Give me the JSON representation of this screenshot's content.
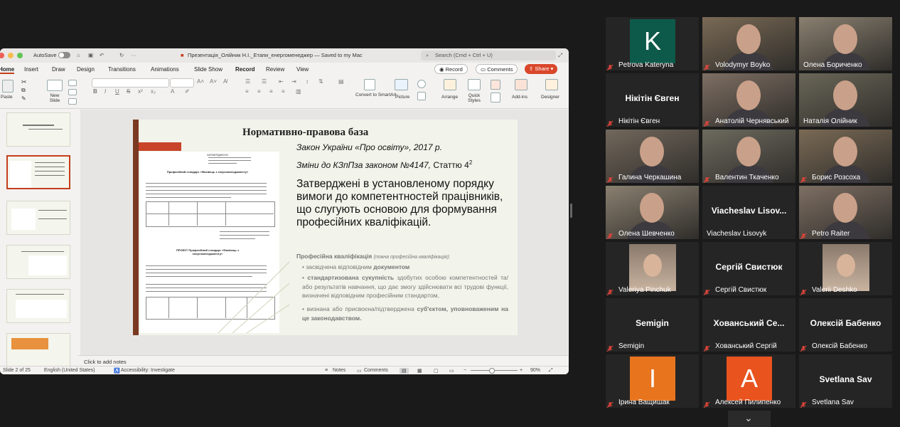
{
  "ppt": {
    "autosave_label": "AutoSave",
    "doc_title": "Презентація_Олійник Н.І._Етапи_енергоменеджер — Saved to my Mac",
    "search_placeholder": "Search (Cmd + Ctrl + U)",
    "tabs": [
      "Home",
      "Insert",
      "Draw",
      "Design",
      "Transitions",
      "Animations",
      "Slide Show",
      "Record",
      "Review",
      "View"
    ],
    "record_label": "Record",
    "comments_label": "Comments",
    "share_label": "Share",
    "ribbon": {
      "paste": "Paste",
      "new_slide": "New Slide",
      "convert": "Convert to SmartArt",
      "picture": "Picture",
      "arrange": "Arrange",
      "quick_styles": "Quick Styles",
      "addins": "Add-ins",
      "designer": "Designer"
    },
    "slide": {
      "title": "Нормативно-правова база",
      "line1": "Закон України «Про освіту», 2017 р.",
      "line2": "Зміни до КЗпПза законом №4147,",
      "line2b": "Статтю 4",
      "line2sup": "2",
      "main": "Затверджені в установленому порядку вимоги до компетентностей працівників, що слугують основою для формування професійних кваліфікацій.",
      "sub_title": "Професійна кваліфікація",
      "sub_title_paren": "(повна професійна кваліфікація):",
      "b1a": "засвідчена відповідним",
      "b1b": "документом",
      "b2a": "стандартизована сукупність",
      "b2b": "здобутих особою компетентностей та/або результатів навчання, що дає змогу здійснювати всі трудові функції, визначені відповідним професійним стандартом,",
      "b3a": "визнана або присвоєна/підтверджена",
      "b3b": "суб'єктом,",
      "b3c": "уповноваженим на це законодавством.",
      "doc_heading1": "Професійний стандарт «Фахівець з енергоменеджменту»",
      "doc_heading2": "ПРОЕКТ Професійний стандарт «Фахівець з енергоменеджменту»",
      "doc_approved": "ЗАТВЕРДЖЕНО"
    },
    "notes_placeholder": "Click to add notes",
    "status": {
      "slide": "Slide 2 of 25",
      "lang": "English (United States)",
      "access": "Accessibility: Investigate",
      "notes": "Notes",
      "comments": "Comments",
      "zoom": "90%"
    }
  },
  "zoom_participants": [
    {
      "name": "Petrova Kateryna",
      "type": "avatar",
      "letter": "K",
      "color": "#0e5a4a",
      "muted": true
    },
    {
      "name": "Volodymyr Boyko",
      "type": "video",
      "muted": true
    },
    {
      "name": "Олена Бориченко",
      "type": "video",
      "muted": false
    },
    {
      "name": "Нікітін Євген",
      "type": "text",
      "big": "Нікітін Євген",
      "muted": true
    },
    {
      "name": "Анатолій Чернявський",
      "type": "video",
      "muted": true
    },
    {
      "name": "Наталія Олійник",
      "type": "video",
      "muted": false,
      "active": true
    },
    {
      "name": "Галина Черкашина",
      "type": "video",
      "muted": true
    },
    {
      "name": "Валентин Ткаченко",
      "type": "video",
      "muted": true
    },
    {
      "name": "Борис Розсоха",
      "type": "video",
      "muted": true
    },
    {
      "name": "Олена Шевченко",
      "type": "video",
      "muted": true
    },
    {
      "name": "Viacheslav Lisovyk",
      "type": "text",
      "big": "Viacheslav  Lisov...",
      "muted": false
    },
    {
      "name": "Petro Raiter",
      "type": "video",
      "muted": true
    },
    {
      "name": "Valeriya Pinchuk",
      "type": "photo",
      "muted": true
    },
    {
      "name": "Сергій Свистюк",
      "type": "text",
      "big": "Сергій Свистюк",
      "muted": true
    },
    {
      "name": "Valerii Deshko",
      "type": "photo",
      "muted": true
    },
    {
      "name": "Semigin",
      "type": "text",
      "big": "Semigin",
      "muted": true
    },
    {
      "name": "Хованський Сергій",
      "type": "text",
      "big": "Хованський  Се...",
      "muted": true
    },
    {
      "name": "Олексій Бабенко",
      "type": "text",
      "big": "Олексій Бабенко",
      "muted": true
    },
    {
      "name": "Ірина Ващишак",
      "type": "avatar",
      "letter": "I",
      "color": "#e8741e",
      "muted": true
    },
    {
      "name": "Алексей Пилипенко",
      "type": "avatar",
      "letter": "A",
      "color": "#e8531e",
      "muted": true
    },
    {
      "name": "Svetlana Sav",
      "type": "text",
      "big": "Svetlana Sav",
      "muted": true
    }
  ],
  "colors": {
    "accent_red": "#c43e1c",
    "share_button": "#d9472b",
    "mute_red": "#e0453a"
  }
}
